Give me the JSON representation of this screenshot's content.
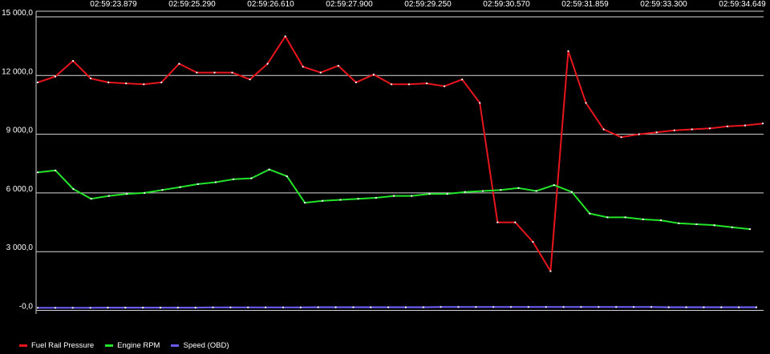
{
  "chart_data": {
    "type": "line",
    "x": [
      "02:59:23.879",
      "02:59:25.290",
      "02:59:26.610",
      "02:59:27.900",
      "02:59:29.250",
      "02:59:30.570",
      "02:59:31.859",
      "02:59:33.300",
      "02:59:34.649"
    ],
    "ylim": [
      -400,
      15000
    ],
    "y_ticks": [
      "15 000,0",
      "12 000,0",
      "9 000,0",
      "6 000,0",
      "3 000,0",
      "-0,0"
    ],
    "y_tick_values": [
      15000,
      12000,
      9000,
      6000,
      3000,
      0
    ],
    "grid": true,
    "legend_position": "bottom-left",
    "series": [
      {
        "name": "Fuel Rail Pressure",
        "color": "#e8161c",
        "values": [
          11650,
          11950,
          12750,
          11850,
          11650,
          11600,
          11550,
          11650,
          12600,
          12150,
          12150,
          12150,
          11800,
          12600,
          14000,
          12450,
          12150,
          12500,
          11650,
          12050,
          11550,
          11550,
          11600,
          11450,
          11800,
          10600,
          4500,
          4500,
          3500,
          2000,
          13250,
          10600,
          9250,
          8850,
          9000,
          9100,
          9200,
          9250,
          9300,
          9400,
          9450,
          9550
        ]
      },
      {
        "name": "Engine RPM",
        "color": "#22e52a",
        "values": [
          7050,
          7150,
          6200,
          5700,
          5850,
          5950,
          6000,
          6150,
          6300,
          6450,
          6550,
          6700,
          6750,
          7200,
          6850,
          5500,
          5600,
          5650,
          5700,
          5750,
          5850,
          5850,
          5950,
          5950,
          6050,
          6100,
          6150,
          6250,
          6100,
          6400,
          6050,
          4950,
          4750,
          4750,
          4650,
          4600,
          4450,
          4400,
          4350,
          4250,
          4150
        ]
      },
      {
        "name": "Speed (OBD)",
        "color": "#6a5cf0",
        "values": [
          130,
          130,
          130,
          130,
          140,
          140,
          140,
          140,
          140,
          140,
          150,
          150,
          150,
          150,
          150,
          150,
          160,
          160,
          160,
          160,
          160,
          160,
          160,
          170,
          170,
          170,
          170,
          170,
          170,
          170,
          170,
          170,
          170,
          170,
          170,
          170,
          160,
          160,
          160,
          160,
          160,
          160
        ]
      }
    ]
  }
}
